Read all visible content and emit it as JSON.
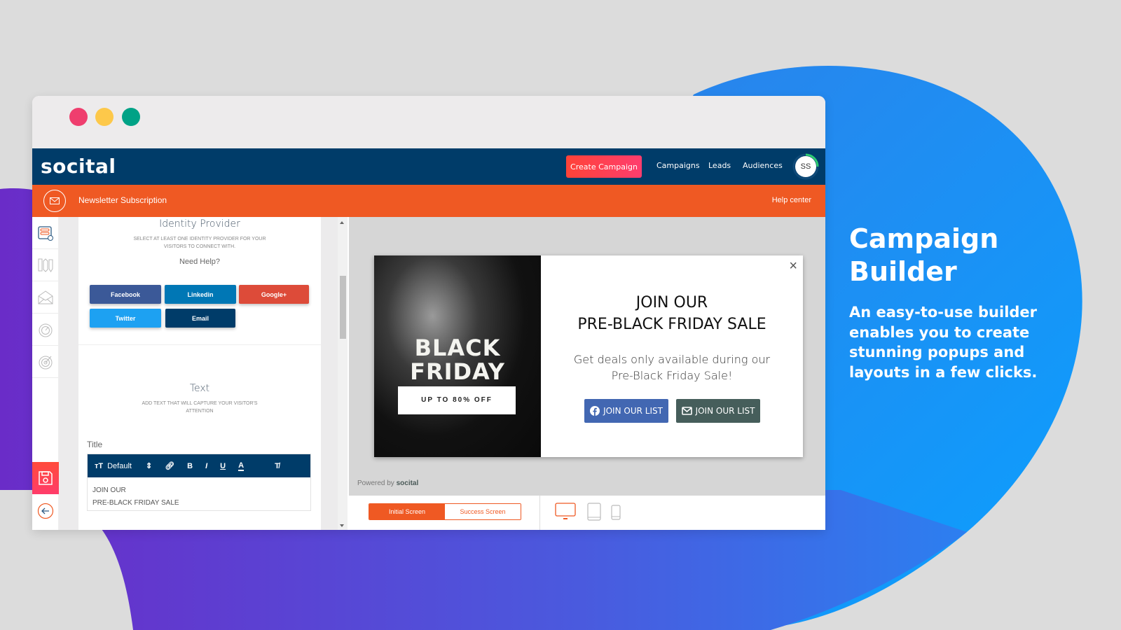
{
  "window": {
    "traffic_lights": [
      "close",
      "minimize",
      "maximize"
    ]
  },
  "topnav": {
    "logo": "socital",
    "create_campaign": "Create Campaign",
    "links": [
      "Campaigns",
      "Leads",
      "Audiences"
    ],
    "avatar_initials": "SS"
  },
  "subbar": {
    "title": "Newsletter Subscription",
    "help": "Help center"
  },
  "rail": {
    "items": [
      "form-settings-icon",
      "design-tools-icon",
      "email-icon",
      "timer-icon",
      "target-icon"
    ],
    "save": "save-icon",
    "back": "back-arrow-icon"
  },
  "panel": {
    "identity": {
      "title": "Identity Provider",
      "desc": "SELECT AT LEAST ONE IDENTITY PROVIDER FOR YOUR VISITORS TO CONNECT WITH.",
      "help": "Need Help?",
      "providers": [
        {
          "label": "Facebook",
          "color": "#3b5998"
        },
        {
          "label": "Linkedin",
          "color": "#0077b5"
        },
        {
          "label": "Google+",
          "color": "#dd4b39"
        },
        {
          "label": "Twitter",
          "color": "#1da1f2"
        },
        {
          "label": "Email",
          "color": "#003c69"
        }
      ]
    },
    "text": {
      "title": "Text",
      "desc": "ADD TEXT THAT WILL CAPTURE YOUR VISITOR'S ATTENTION",
      "field_label": "Title",
      "toolbar": {
        "font_size": "Default",
        "bold": "B",
        "italic": "I",
        "underline": "U",
        "color": "A"
      },
      "value_line1": "JOIN OUR",
      "value_line2": "PRE-BLACK FRIDAY SALE"
    }
  },
  "preview": {
    "image_title_line1": "BLACK",
    "image_title_line2": "FRIDAY",
    "image_tag": "UP TO 80% OFF",
    "close": "×",
    "headline_line1": "JOIN OUR",
    "headline_line2": "PRE-BLACK FRIDAY SALE",
    "sub_line1": "Get deals only available during our",
    "sub_line2": "Pre-Black Friday Sale!",
    "btn_facebook": "JOIN OUR LIST",
    "btn_email": "JOIN OUR LIST",
    "powered_prefix": "Powered by",
    "powered_brand": "socital"
  },
  "bottombar": {
    "initial": "Initial Screen",
    "success": "Success Screen",
    "devices": [
      "desktop",
      "tablet",
      "mobile"
    ],
    "active_device": "desktop"
  },
  "promo": {
    "title_line1": "Campaign",
    "title_line2": "Builder",
    "desc": "An easy-to-use builder enables you to create stunning popups and layouts in a few clicks."
  },
  "colors": {
    "navy": "#003c69",
    "orange": "#ef5923",
    "red_cta": "#ff4338",
    "blue_blob": "#1e90ff",
    "purple_blob": "#6a2fc9"
  }
}
